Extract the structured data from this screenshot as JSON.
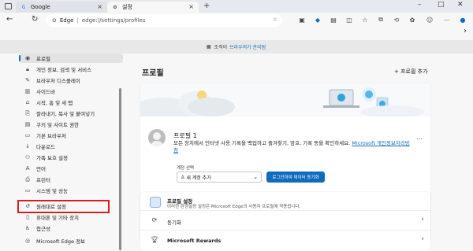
{
  "browser": {
    "tabs": [
      {
        "label": "Google",
        "icon": "google-icon"
      },
      {
        "label": "설정",
        "icon": "gear-icon"
      }
    ],
    "address": {
      "brand": "Edge",
      "url": "edge://settings/profiles"
    }
  },
  "managed_banner": {
    "pre": "조직",
    "middle": "이",
    "link": "브라우저가 관리됨",
    "tail": ""
  },
  "sidebar": {
    "items": [
      {
        "label": "프로필",
        "icon": "person-icon"
      },
      {
        "label": "개인 정보, 검색 및 서비스",
        "icon": "lock-icon"
      },
      {
        "label": "브라우저 디스플레이",
        "icon": "brush-icon"
      },
      {
        "label": "사이드바",
        "icon": "sidebar-icon"
      },
      {
        "label": "시작, 홈 및 새 탭",
        "icon": "home-icon"
      },
      {
        "label": "잘라내기, 복사 및 붙여넣기",
        "icon": "clipboard-icon"
      },
      {
        "label": "쿠키 및 사이트 권한",
        "icon": "cookie-icon"
      },
      {
        "label": "기본 브라우저",
        "icon": "browser-icon"
      },
      {
        "label": "다운로드",
        "icon": "download-icon"
      },
      {
        "label": "가족 보호 설정",
        "icon": "family-icon"
      },
      {
        "label": "언어",
        "icon": "language-icon"
      },
      {
        "label": "프린터",
        "icon": "printer-icon"
      },
      {
        "label": "시스템 및 성능",
        "icon": "system-icon"
      },
      {
        "label": "원래대로 설정",
        "icon": "reset-icon"
      },
      {
        "label": "휴대폰 및 기타 장치",
        "icon": "phone-icon"
      },
      {
        "label": "접근성",
        "icon": "accessibility-icon"
      },
      {
        "label": "Microsoft Edge 정보",
        "icon": "edge-icon"
      }
    ]
  },
  "main": {
    "title": "프로필",
    "add_profile": "프로필 추가",
    "profile": {
      "name": "프로필 1",
      "desc": "모든 장치에서 인터넷 사용 기록을 백업하고 즐겨찾기, 암호, 기록 등을 확인하세요.",
      "link": "Microsoft 개인정보처리방침",
      "account_label": "계정 선택",
      "account_value": "새 계정 추가",
      "sync_button": "로그인하여 데이터 동기화"
    },
    "settings_rows": [
      {
        "title": "프로필 설정",
        "sub": "이러한 환경설정 설정은 Microsoft Edge의 사용자 프로필에 적용됩니다."
      },
      {
        "title": "동기화",
        "sub": ""
      },
      {
        "title": "Microsoft Rewards",
        "sub": ""
      }
    ]
  },
  "colors": {
    "accent": "#0f6cbd",
    "highlight": "#d81f1f"
  }
}
